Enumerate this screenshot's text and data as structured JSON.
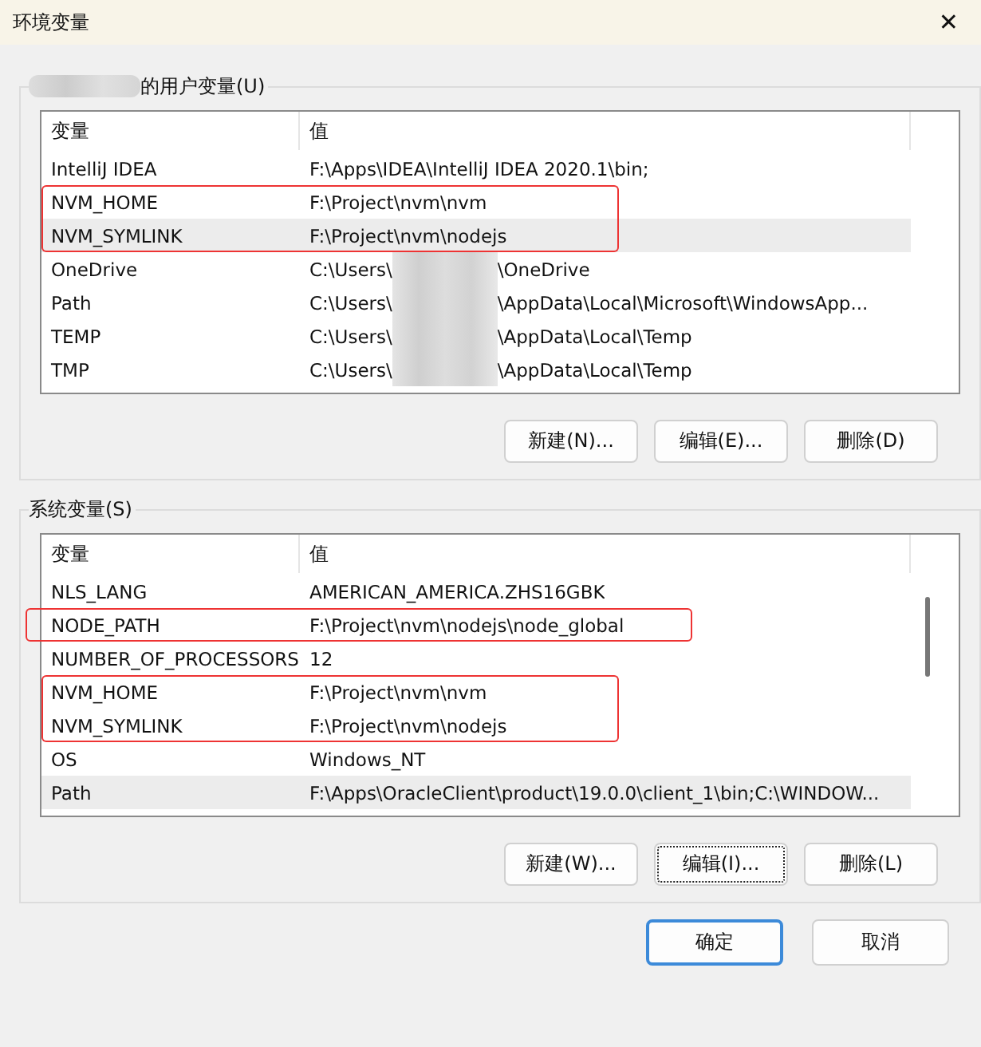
{
  "window": {
    "title": "环境变量",
    "close": "✕"
  },
  "groups": [
    {
      "label_redacted": true,
      "label": "的用户变量(U)",
      "columns": [
        "变量",
        "值"
      ],
      "scrollbar": false,
      "rows": [
        {
          "name": "IntelliJ IDEA",
          "value": "F:\\Apps\\IDEA\\IntelliJ IDEA 2020.1\\bin;",
          "selected": false,
          "highlighted": false
        },
        {
          "name": "NVM_HOME",
          "value": "F:\\Project\\nvm\\nvm",
          "selected": false,
          "highlighted": true
        },
        {
          "name": "NVM_SYMLINK",
          "value": "F:\\Project\\nvm\\nodejs",
          "selected": true,
          "highlighted": true
        },
        {
          "name": "OneDrive",
          "value": "C:\\Users\\",
          "value_tail": "\\OneDrive",
          "selected": false,
          "highlighted": false
        },
        {
          "name": "Path",
          "value": "C:\\Users\\",
          "value_tail": "\\AppData\\Local\\Microsoft\\WindowsApp...",
          "selected": false,
          "highlighted": false
        },
        {
          "name": "TEMP",
          "value": "C:\\Users\\",
          "value_tail": "\\AppData\\Local\\Temp",
          "selected": false,
          "highlighted": false
        },
        {
          "name": "TMP",
          "value": "C:\\Users\\",
          "value_tail": "\\AppData\\Local\\Temp",
          "selected": false,
          "highlighted": false
        }
      ],
      "buttons": [
        {
          "label": "新建(N)...",
          "focused": false
        },
        {
          "label": "编辑(E)...",
          "focused": false
        },
        {
          "label": "删除(D)",
          "focused": false
        }
      ]
    },
    {
      "label_redacted": false,
      "label": "系统变量(S)",
      "columns": [
        "变量",
        "值"
      ],
      "scrollbar": true,
      "rows": [
        {
          "name": "NLS_LANG",
          "value": "AMERICAN_AMERICA.ZHS16GBK",
          "selected": false,
          "highlighted": false
        },
        {
          "name": "NODE_PATH",
          "value": "F:\\Project\\nvm\\nodejs\\node_global",
          "selected": false,
          "highlighted": true
        },
        {
          "name": "NUMBER_OF_PROCESSORS",
          "value": "12",
          "selected": false,
          "highlighted": false
        },
        {
          "name": "NVM_HOME",
          "value": "F:\\Project\\nvm\\nvm",
          "selected": false,
          "highlighted": true
        },
        {
          "name": "NVM_SYMLINK",
          "value": "F:\\Project\\nvm\\nodejs",
          "selected": false,
          "highlighted": true
        },
        {
          "name": "OS",
          "value": "Windows_NT",
          "selected": false,
          "highlighted": false
        },
        {
          "name": "Path",
          "value": "F:\\Apps\\OracleClient\\product\\19.0.0\\client_1\\bin;C:\\WINDOW...",
          "selected": true,
          "highlighted": false
        }
      ],
      "buttons": [
        {
          "label": "新建(W)...",
          "focused": false
        },
        {
          "label": "编辑(I)...",
          "focused": true
        },
        {
          "label": "删除(L)",
          "focused": false
        }
      ]
    }
  ],
  "footer_buttons": [
    {
      "label": "确定",
      "default": true
    },
    {
      "label": "取消",
      "default": false
    }
  ]
}
